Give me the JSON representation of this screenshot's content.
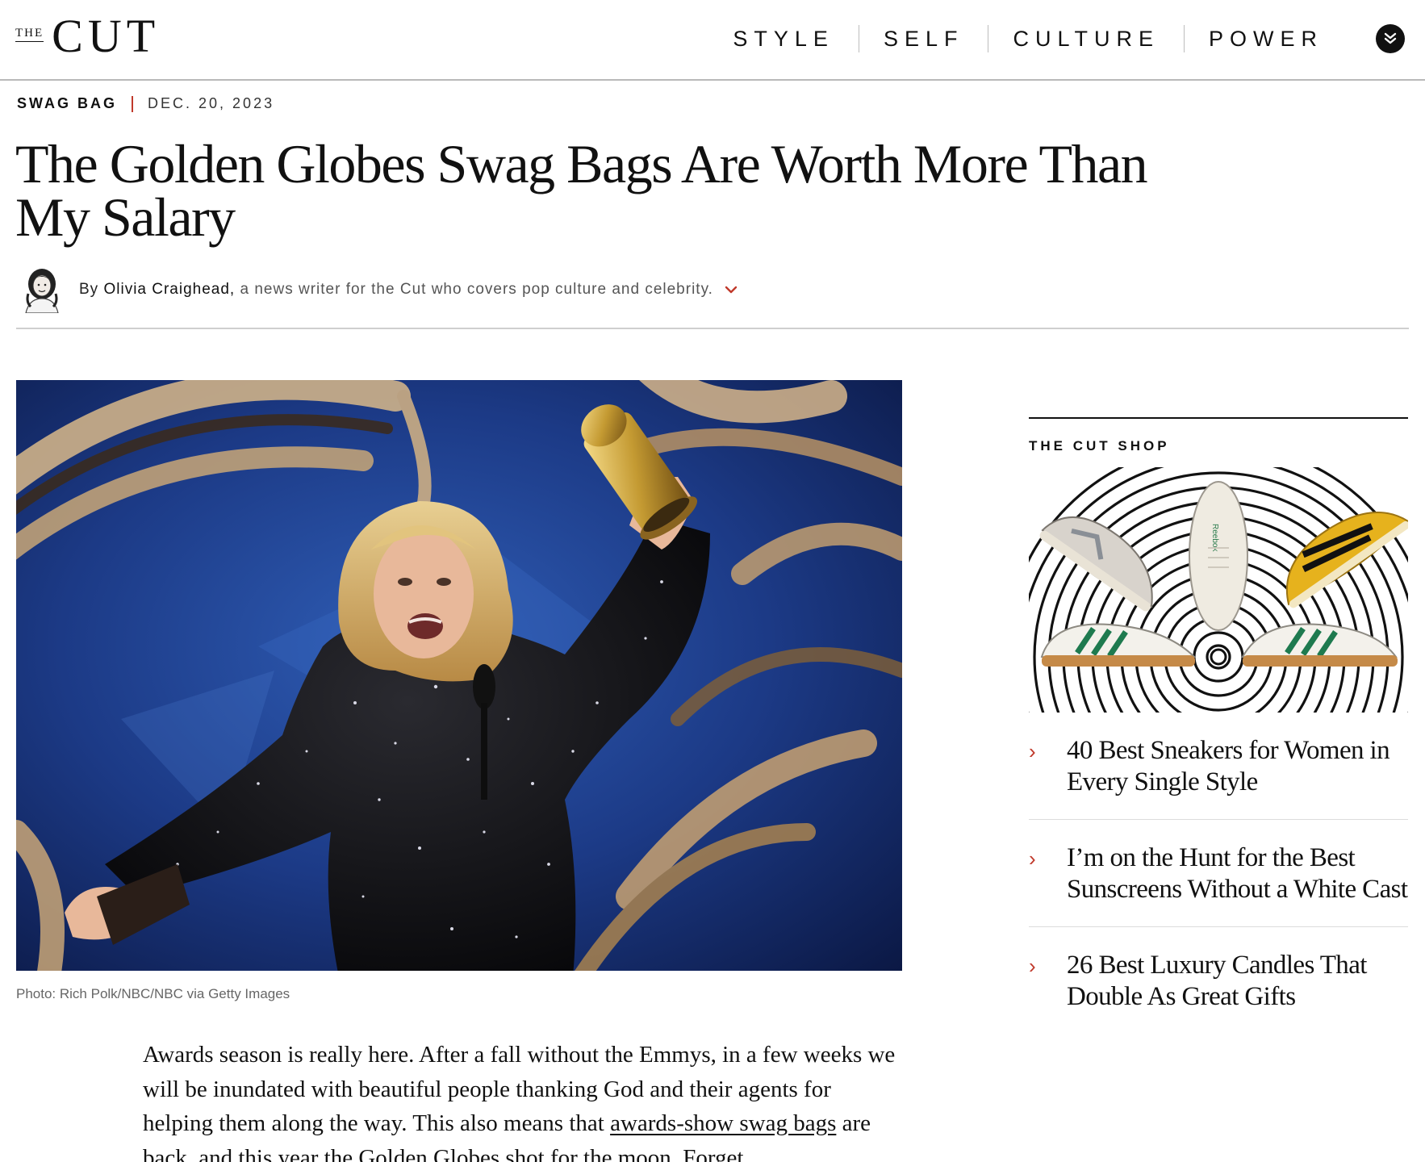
{
  "header": {
    "logo_the": "THE",
    "logo_cut": "CUT",
    "nav": [
      "STYLE",
      "SELF",
      "CULTURE",
      "POWER"
    ]
  },
  "article": {
    "rubric": "SWAG BAG",
    "date": "DEC. 20, 2023",
    "headline": "The Golden Globes Swag Bags Are Worth More Than My Salary",
    "byline_prefix": "By",
    "author": "Olivia Craighead,",
    "author_bio": "a news writer for the Cut who covers pop culture and celebrity.",
    "photo_caption": "Photo: Rich Polk/NBC/NBC via Getty Images",
    "body_part1": "Awards season is really here. After a fall without the Emmys, in a few weeks we will be inundated with beautiful people thanking God and their agents for helping them along the way. This also means that ",
    "body_link": "awards-show swag bags",
    "body_part2": " are back, and this year the Golden Globes shot for the moon. Forget"
  },
  "sidebar": {
    "shop_title": "THE CUT SHOP",
    "items": [
      {
        "label": "40 Best Sneakers for Women in Every Single Style"
      },
      {
        "label": "I’m on the Hunt for the Best Sunscreens Without a White Cast"
      },
      {
        "label": "26 Best Luxury Candles That Double As Great Gifts"
      }
    ]
  },
  "colors": {
    "accent_red": "#c0392b",
    "text": "#111111",
    "rule": "#cfcfcf"
  },
  "icons": {
    "menu": "double-chevron-down-icon",
    "byline_toggle": "chevron-down-icon",
    "shop_arrow": "chevron-right-icon"
  }
}
